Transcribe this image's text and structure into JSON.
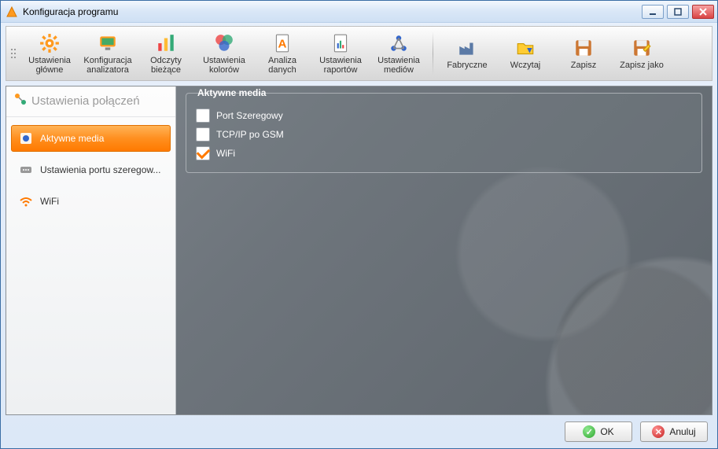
{
  "window": {
    "title": "Konfiguracja programu"
  },
  "toolbar": {
    "group1": [
      {
        "label": "Ustawienia główne",
        "icon": "gear-orange"
      },
      {
        "label": "Konfiguracja analizatora",
        "icon": "monitor"
      },
      {
        "label": "Odczyty bieżące",
        "icon": "bars"
      },
      {
        "label": "Ustawienia kolorów",
        "icon": "palette"
      },
      {
        "label": "Analiza danych",
        "icon": "page-a"
      },
      {
        "label": "Ustawienia raportów",
        "icon": "report"
      },
      {
        "label": "Ustawienia mediów",
        "icon": "network"
      }
    ],
    "group2": [
      {
        "label": "Fabryczne",
        "icon": "factory"
      },
      {
        "label": "Wczytaj",
        "icon": "folder-open"
      },
      {
        "label": "Zapisz",
        "icon": "floppy"
      },
      {
        "label": "Zapisz jako",
        "icon": "floppy-as"
      }
    ]
  },
  "sidebar": {
    "header": "Ustawienia połączeń",
    "items": [
      {
        "label": "Aktywne media",
        "active": true
      },
      {
        "label": "Ustawienia portu szeregow...",
        "active": false
      },
      {
        "label": "WiFi",
        "active": false
      }
    ]
  },
  "group": {
    "legend": "Aktywne media",
    "checkboxes": [
      {
        "label": "Port Szeregowy",
        "checked": false
      },
      {
        "label": "TCP/IP po GSM",
        "checked": false
      },
      {
        "label": "WiFi",
        "checked": true
      }
    ]
  },
  "buttons": {
    "ok": "OK",
    "cancel": "Anuluj"
  }
}
